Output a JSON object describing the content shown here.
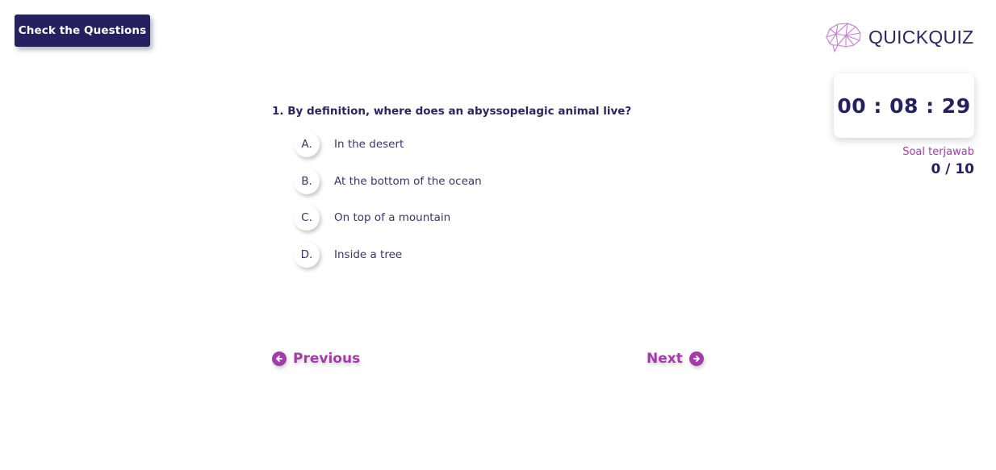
{
  "header": {
    "check_button_label": "Check the Questions",
    "brand_name": "QUICKQUIZ",
    "brand_icon": "brain-network-icon"
  },
  "timer": {
    "display": "00 : 08 : 29"
  },
  "progress": {
    "label": "Soal terjawab",
    "count": "0 / 10",
    "answered": 0,
    "total": 10
  },
  "question": {
    "text": "1.  By definition, where does an abyssopelagic animal live?",
    "options": [
      {
        "letter": "A.",
        "text": "In the desert"
      },
      {
        "letter": "B.",
        "text": "At the bottom of the ocean"
      },
      {
        "letter": "C.",
        "text": "On top of a mountain"
      },
      {
        "letter": "D.",
        "text": "Inside a tree"
      }
    ]
  },
  "navigation": {
    "previous_label": "Previous",
    "next_label": "Next",
    "previous_icon": "arrow-left-circle-icon",
    "next_icon": "arrow-right-circle-icon"
  },
  "colors": {
    "primary": "#25205f",
    "accent": "#a23ca9",
    "brand_icon": "#c77fd0"
  }
}
